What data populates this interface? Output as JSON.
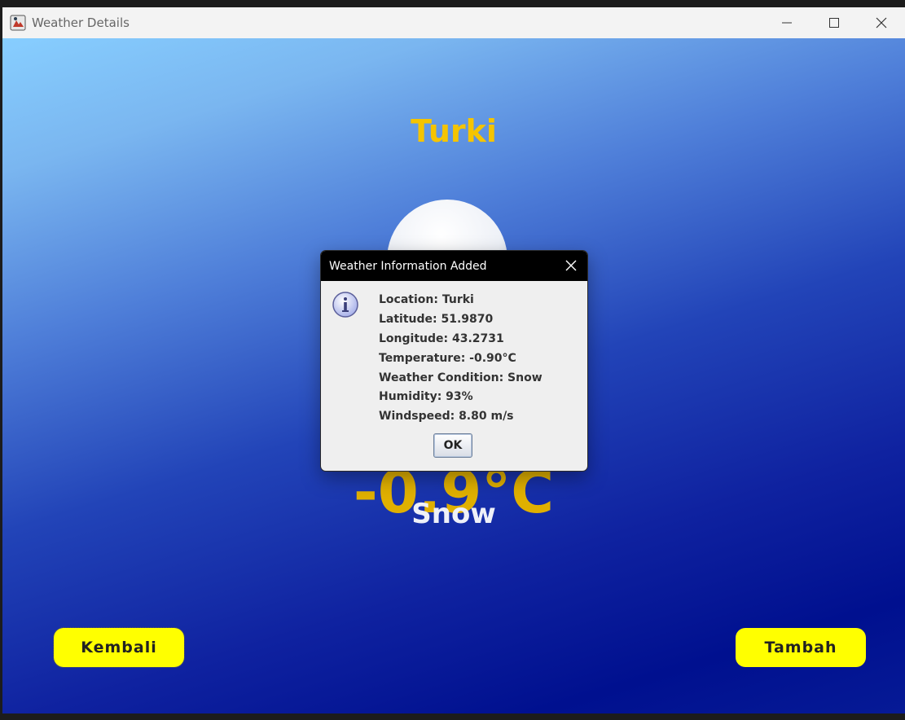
{
  "window": {
    "title": "Weather Details",
    "icons": [
      "java-app-icon",
      "minimize-icon",
      "maximize-icon",
      "close-icon"
    ]
  },
  "weather": {
    "city": "Turki",
    "temperature": "-0.9°C",
    "condition": "Snow",
    "icon": "cloud-icon"
  },
  "buttons": {
    "back_label": "Kembali",
    "add_label": "Tambah"
  },
  "dialog": {
    "title": "Weather Information Added",
    "icon": "info-icon",
    "lines": [
      "Location: Turki",
      "Latitude: 51.9870",
      "Longitude: 43.2731",
      "Temperature: -0.90°C",
      "Weather Condition: Snow",
      "Humidity: 93%",
      "Windspeed: 8.80 m/s"
    ],
    "ok_label": "OK"
  },
  "colors": {
    "city_text": "#f5c400",
    "temperature_text": "#e0b000",
    "button_bg": "#ffff00",
    "sky_top": "#87ceff",
    "sky_bottom": "#00108f"
  }
}
